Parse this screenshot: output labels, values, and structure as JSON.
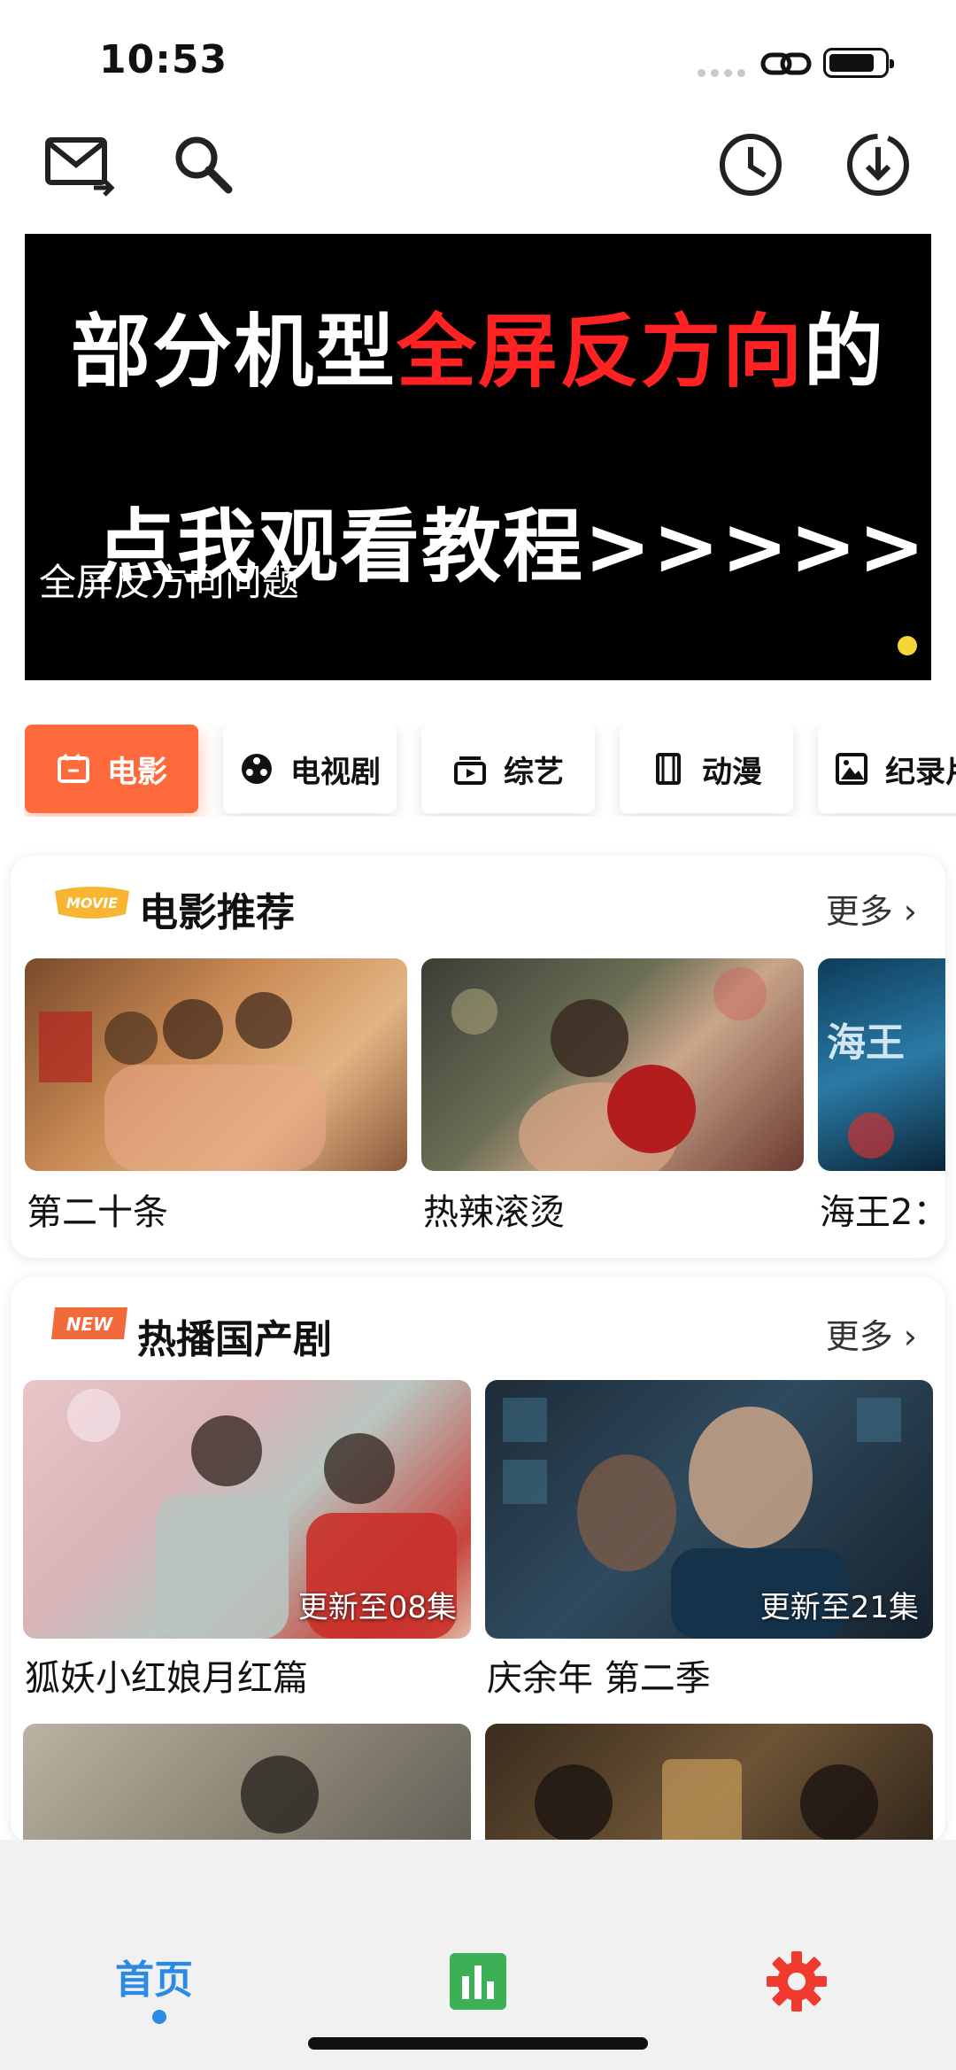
{
  "status_bar": {
    "time": "10:53"
  },
  "banner": {
    "line1_white": "部分机型",
    "line1_red": "全屏反方向",
    "line1_end": "的",
    "line2": "点我观看教程>>>>>",
    "caption": "全屏反方向问题",
    "indicator_color": "#f5d638"
  },
  "tabs": [
    {
      "label": "电影",
      "icon": "film-icon",
      "active": true
    },
    {
      "label": "电视剧",
      "icon": "tv-reel-icon",
      "active": false
    },
    {
      "label": "综艺",
      "icon": "variety-icon",
      "active": false
    },
    {
      "label": "动漫",
      "icon": "anime-icon",
      "active": false
    },
    {
      "label": "纪录片",
      "icon": "documentary-icon",
      "active": false
    }
  ],
  "movie_section": {
    "badge": "MOVIE",
    "title": "电影推荐",
    "more": "更多",
    "items": [
      {
        "title": "第二十条"
      },
      {
        "title": "热辣滚烫"
      },
      {
        "title": "海王2："
      }
    ]
  },
  "drama_section": {
    "badge": "NEW",
    "title": "热播国产剧",
    "more": "更多",
    "items": [
      {
        "title": "狐妖小红娘月红篇",
        "episode": "更新至08集"
      },
      {
        "title": "庆余年 第二季",
        "episode": "更新至21集"
      }
    ]
  },
  "bottom_nav": {
    "home": "首页",
    "accent": "#2a8ae6",
    "stats_color": "#3cb054",
    "settings_color": "#f03a2e"
  },
  "colors": {
    "tab_active": "#ff6a3d"
  }
}
